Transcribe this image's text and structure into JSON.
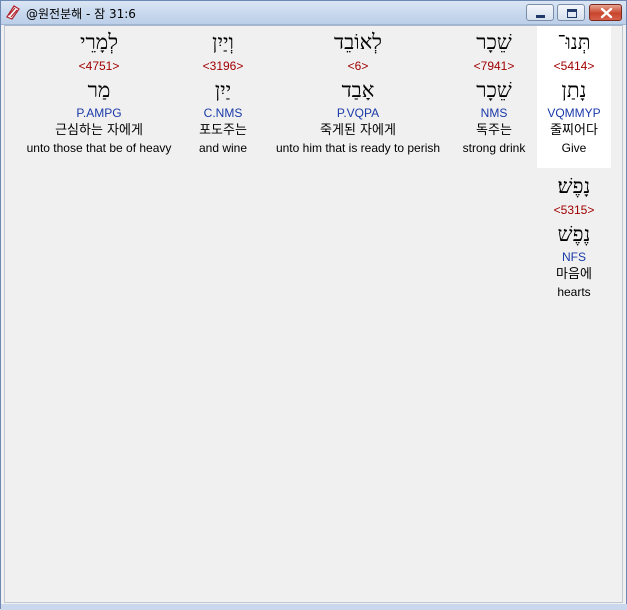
{
  "window": {
    "title": "@원전분해 - 잠 31:6",
    "icon": "bible-app-icon"
  },
  "words": [
    {
      "hebrew": "תְּנוּ־",
      "strong": "<5414>",
      "lemma": "נָתַן",
      "morph": "VQMMYP",
      "korean": "줄찌어다",
      "english": "Give",
      "highlighted": true
    },
    {
      "hebrew": "שֵׁכָר",
      "strong": "<7941>",
      "lemma": "שֵׁכָר",
      "morph": "NMS",
      "korean": "독주는",
      "english": "strong drink"
    },
    {
      "hebrew": "לְאוֹבֵד",
      "strong": "<6>",
      "lemma": "אָבַד",
      "morph": "P.VQPA",
      "korean": "죽게된 자에게",
      "english": "unto him that is ready to perish"
    },
    {
      "hebrew": "וְיַיִן",
      "strong": "<3196>",
      "lemma": "יַיִן",
      "morph": "C.NMS",
      "korean": "포도주는",
      "english": "and wine"
    },
    {
      "hebrew": "לְמָרֵי",
      "strong": "<4751>",
      "lemma": "מַר",
      "morph": "P.AMPG",
      "korean": "근심하는 자에게",
      "english": "unto those that be of heavy"
    },
    {
      "hebrew": "נָפֶשׁ׃",
      "strong": "<5315>",
      "lemma": "נֶפֶשׁ",
      "morph": "NFS",
      "korean": "마음에",
      "english": "hearts"
    }
  ]
}
